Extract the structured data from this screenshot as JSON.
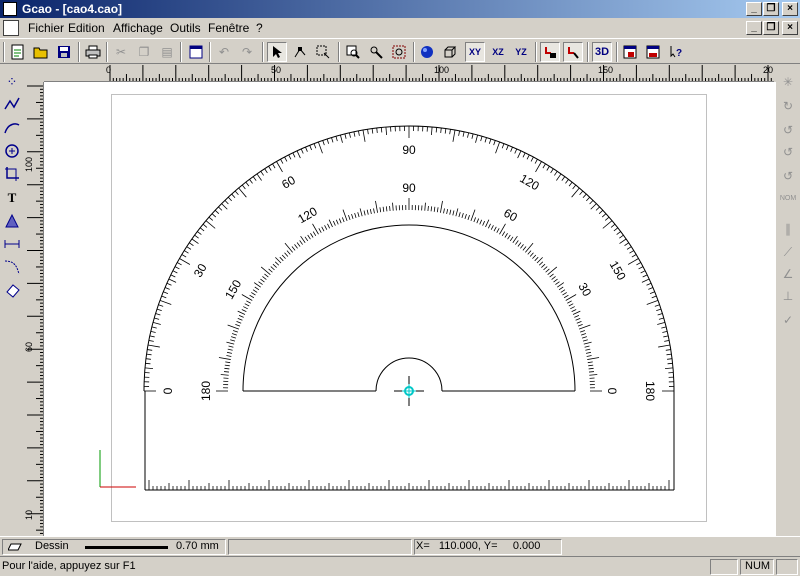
{
  "window": {
    "title": "Gcao - [cao4.cao]"
  },
  "menu": [
    {
      "label": "Fichier"
    },
    {
      "label": "Edition"
    },
    {
      "label": "Affichage"
    },
    {
      "label": "Outils"
    },
    {
      "label": "Fenêtre"
    },
    {
      "label": "?"
    }
  ],
  "toolbar": {
    "xy_label": "XY",
    "xz_label": "XZ",
    "yz_label": "YZ",
    "view3d_label": "3D"
  },
  "ruler": {
    "h_labels": [
      "0",
      "50",
      "100",
      "150",
      "20"
    ],
    "v_labels": [
      "100",
      "60",
      "10"
    ]
  },
  "protractor": {
    "outer_labels": [
      "0",
      "30",
      "60",
      "90",
      "120",
      "150",
      "180"
    ],
    "inner_labels": [
      "180",
      "150",
      "120",
      "90",
      "60",
      "30",
      "0"
    ]
  },
  "status": {
    "layer_label": "Dessin",
    "line_width": "0.70 mm",
    "coords": "X=   110.000, Y=     0.000",
    "help": "Pour l'aide, appuyez sur F1",
    "num_indicator": "NUM"
  },
  "colors": {
    "titlebar_start": "#0a246a",
    "titlebar_end": "#a6caf0",
    "cursor": "#00c8c8",
    "axis_x": "#cc0000",
    "axis_y": "#009900"
  }
}
